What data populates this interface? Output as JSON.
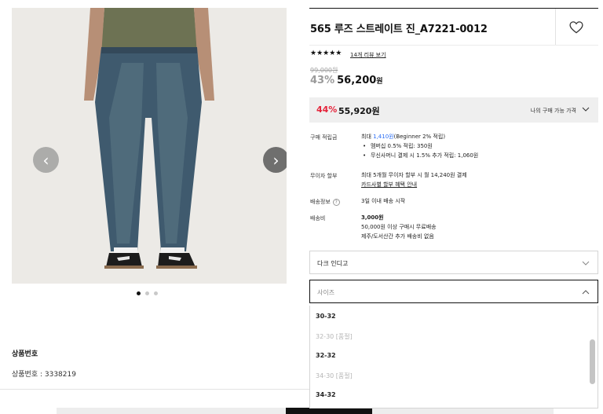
{
  "gallery": {
    "prev_glyph": "‹",
    "next_glyph": "›",
    "dots": 3,
    "active_dot": 0
  },
  "product": {
    "title": "565 루즈 스트레이트 진_A7221-0012",
    "rating_stars": "★★★★★",
    "review_link": "14개 리뷰 보기",
    "original_price": "99,000원",
    "discount_pct": "43%",
    "discount_price": "56,200",
    "discount_won": "원"
  },
  "my_price": {
    "pct": "44%",
    "price": "55,920원",
    "label": "나의 구매 가능 가격"
  },
  "info": {
    "points_label": "구매 적립금",
    "points_prefix": "최대 ",
    "points_amount": "1,410원",
    "points_suffix": "(Beginner 2% 적립)",
    "points_bullet_1": "멤버십 0.5% 적립: 350원",
    "points_bullet_2": "무신사머니 결제 시 1.5% 추가 적립: 1,060원",
    "installment_label": "무이자 할부",
    "installment_text": "최대 5개월 무이자 할부 시 월 14,240원 결제",
    "installment_link": "카드사별 할부 혜택 안내",
    "shipping_label": "배송정보",
    "shipping_help": "?",
    "shipping_text": "3일 이내 배송 시작",
    "fee_label": "배송비",
    "fee_amount": "3,000원",
    "fee_line_1": "50,000원 이상 구매시 무료배송",
    "fee_line_2": "제주/도서산간 추가 배송비 없음"
  },
  "selects": {
    "color_value": "다크 인디고",
    "size_placeholder": "사이즈"
  },
  "size_options": [
    {
      "label": "30-32",
      "status": "available"
    },
    {
      "label": "32-30 [품절]",
      "status": "soldout"
    },
    {
      "label": "32-32",
      "status": "available"
    },
    {
      "label": "34-30 [품절]",
      "status": "soldout"
    },
    {
      "label": "34-32",
      "status": "available"
    }
  ],
  "product_number": {
    "title": "상품번호",
    "line": "상품번호 : 3338219"
  },
  "colors": {
    "accent_red": "#e5243b",
    "points_blue": "#2a6df4"
  }
}
